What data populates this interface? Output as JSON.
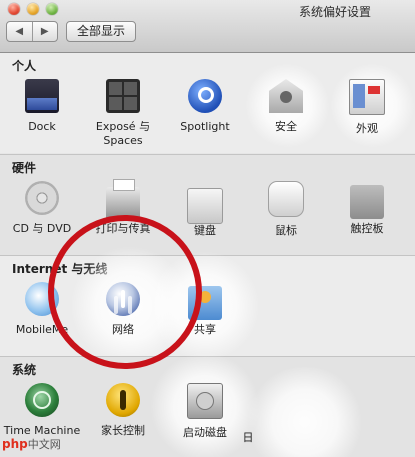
{
  "window": {
    "title": "系统偏好设置"
  },
  "toolbar": {
    "back_label": "◀",
    "forward_label": "▶",
    "show_all_label": "全部显示"
  },
  "sections": {
    "personal": {
      "title": "个人",
      "items": [
        {
          "label": "Dock",
          "icon": "dock-icon"
        },
        {
          "label": "Exposé 与\nSpaces",
          "icon": "expose-icon"
        },
        {
          "label": "Spotlight",
          "icon": "spotlight-icon"
        },
        {
          "label": "安全",
          "icon": "security-icon"
        },
        {
          "label": "外观",
          "icon": "appearance-icon"
        }
      ]
    },
    "hardware": {
      "title": "硬件",
      "items": [
        {
          "label": "CD 与 DVD",
          "icon": "cd-dvd-icon"
        },
        {
          "label": "打印与传真",
          "icon": "print-fax-icon"
        },
        {
          "label": "键盘",
          "icon": "keyboard-icon"
        },
        {
          "label": "鼠标",
          "icon": "mouse-icon"
        },
        {
          "label": "触控板",
          "icon": "trackpad-icon"
        }
      ]
    },
    "internet": {
      "title": "Internet 与无线",
      "items": [
        {
          "label": "MobileMe",
          "icon": "mobileme-icon"
        },
        {
          "label": "网络",
          "icon": "network-icon"
        },
        {
          "label": "共享",
          "icon": "sharing-icon"
        }
      ]
    },
    "system": {
      "title": "系统",
      "items": [
        {
          "label": "Time Machine",
          "icon": "time-machine-icon"
        },
        {
          "label": "家长控制",
          "icon": "parental-controls-icon"
        },
        {
          "label": "启动磁盘",
          "icon": "startup-disk-icon"
        },
        {
          "label": "日",
          "icon": "date-time-icon"
        }
      ]
    }
  },
  "watermark": {
    "brand": "php",
    "site": "中文网"
  },
  "colors": {
    "highlight_ring": "#c8121a",
    "watermark": "#e0301e"
  }
}
